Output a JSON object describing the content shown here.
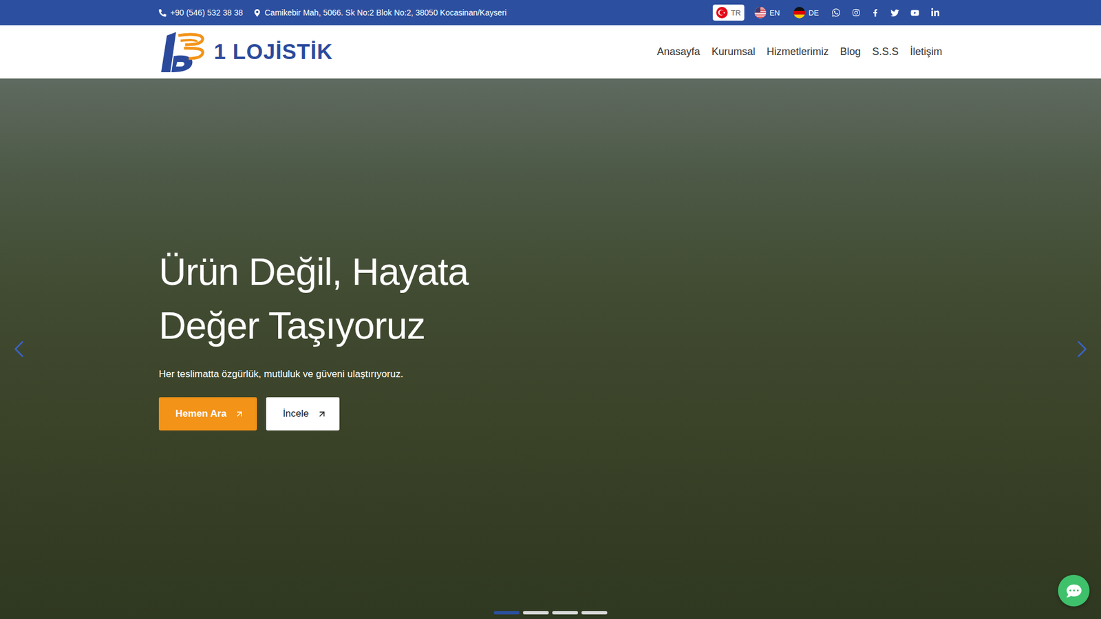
{
  "topbar": {
    "phone": "+90 (546) 532 38 38",
    "address": "Camikebir Mah, 5066. Sk No:2 Blok No:2, 38050 Kocasinan/Kayseri",
    "languages": [
      {
        "label": "TR",
        "kind": "tr",
        "selected": true
      },
      {
        "label": "EN",
        "kind": "en",
        "selected": false
      },
      {
        "label": "DE",
        "kind": "de",
        "selected": false
      }
    ]
  },
  "logo": {
    "text": "1 LOJİSTİK"
  },
  "nav": [
    {
      "label": "Anasayfa",
      "selected": false
    },
    {
      "label": "Kurumsal",
      "selected": false
    },
    {
      "label": "Hizmetlerimiz",
      "selected": false
    },
    {
      "label": "Blog",
      "selected": false
    },
    {
      "label": "S.S.S",
      "selected": false
    },
    {
      "label": "İletişim",
      "selected": false
    }
  ],
  "hero": {
    "title_lines": [
      "Ürün Değil, Hayata",
      "Değer Taşıyoruz"
    ],
    "subtitle": "Her teslimatta özgürlük, mutluluk ve güveni ulaştırıyoruz.",
    "buttons": [
      {
        "label": "Hemen Ara",
        "kind": "primary"
      },
      {
        "label": "İncele",
        "kind": "secondary"
      }
    ]
  },
  "slider": {
    "dots": [
      {
        "selected": true
      },
      {
        "selected": false
      },
      {
        "selected": false
      },
      {
        "selected": false
      }
    ]
  }
}
